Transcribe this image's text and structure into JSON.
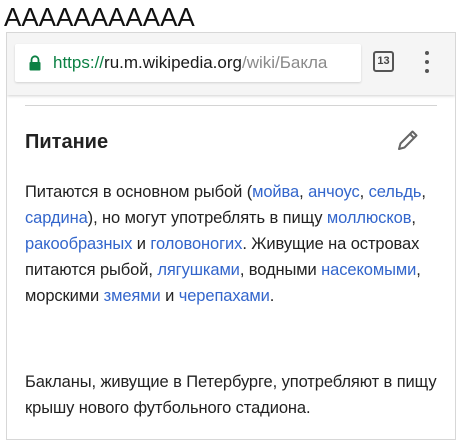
{
  "caption": "ААААААААААА",
  "browser": {
    "url_scheme": "https://",
    "url_host": "ru.m.wikipedia.org",
    "url_path": "/wiki/Бакла",
    "tab_count": "13"
  },
  "article": {
    "section_title": "Питание",
    "p1": {
      "t1": "Питаются в основном рыбой (",
      "l1": "мойва",
      "t2": ", ",
      "l2": "анчоус",
      "t3": ", ",
      "l3": "сельдь",
      "t4": ", ",
      "l4": "сардина",
      "t5": "), но могут употреблять в пищу ",
      "l5": "моллюсков",
      "t6": ", ",
      "l6": "ракообразных",
      "t7": " и ",
      "l7": "головоногих",
      "t8": ". Живущие на островах питаются рыбой, ",
      "l8": "лягушками",
      "t9": ", водными ",
      "l9": "насекомыми",
      "t10": ", морскими ",
      "l10": "змеями",
      "t11": " и ",
      "l11": "черепахами",
      "t12": "."
    },
    "p2": "Бакланы, живущие в Петербурге, употребляют в пищу крышу нового футбольного стадиона."
  },
  "colors": {
    "link": "#3366cc",
    "secure_scheme": "#0b8043",
    "text": "#222222"
  },
  "icons": [
    "lock-icon",
    "tabs-count-icon",
    "overflow-menu-icon",
    "edit-pencil-icon"
  ]
}
